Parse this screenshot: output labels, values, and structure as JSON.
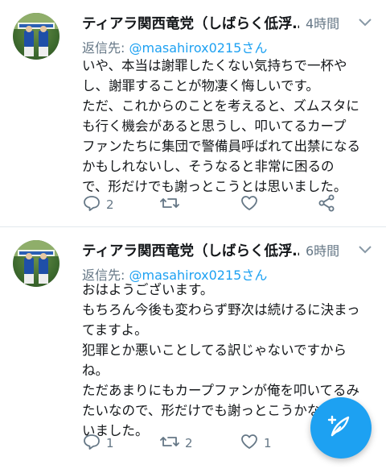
{
  "tweets": [
    {
      "author": "ティアラ関西竜党（しばらく低浮…",
      "time": "4時間",
      "reply_prefix": "返信先: ",
      "reply_handle": "@masahirox0215さん",
      "lines": [
        "いや、本当は謝罪したくない気持ちで一杯や",
        "し、謝罪することが物凄く悔しいです。",
        "ただ、これからのことを考えると、ズムスタに",
        "も行く機会があると思うし、叩いてるカープ",
        "ファンたちに集団で警備員呼ばれて出禁になる",
        "かもしれないし、そうなると非常に困るの",
        "で、形だけでも謝っとこうとは思いました。"
      ],
      "reply_count": "2",
      "retweet_count": "",
      "like_count": ""
    },
    {
      "author": "ティアラ関西竜党（しばらく低浮…",
      "time": "6時間",
      "reply_prefix": "返信先: ",
      "reply_handle": "@masahirox0215さん",
      "lines": [
        "おはようございます。",
        "もちろん今後も変わらず野次は続けるに決まっ",
        "てますよ。",
        "犯罪とか悪いことしてる訳じゃないですから",
        "ね。",
        "ただあまりにもカープファンが俺を叩いてるみ",
        "たいなので、形だけでも謝っとこうかなとは思",
        "いました。"
      ],
      "reply_count": "1",
      "retweet_count": "2",
      "like_count": "1"
    }
  ],
  "colors": {
    "accent": "#1da1f2",
    "secondary_text": "#657786",
    "divider": "#e1e8ed"
  },
  "icons": {
    "reply": "reply-icon",
    "retweet": "retweet-icon",
    "like": "heart-icon",
    "share": "share-icon",
    "caret": "chevron-down-icon",
    "compose": "compose-tweet-icon"
  }
}
